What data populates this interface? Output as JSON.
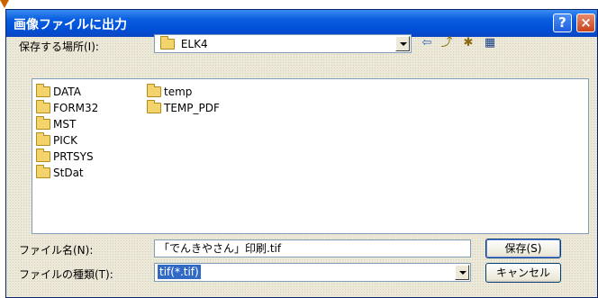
{
  "dialog": {
    "title": "画像ファイルに出力",
    "help_label": "?",
    "close_label": "×"
  },
  "location": {
    "label": "保存する場所(I):",
    "folder": "ELK4"
  },
  "toolbar": {
    "back_icon": "⇦",
    "up_icon": "⤴",
    "new_folder_icon": "✱",
    "view_menu_icon": "▦"
  },
  "files": [
    {
      "name": "DATA"
    },
    {
      "name": "FORM32"
    },
    {
      "name": "MST"
    },
    {
      "name": "PICK"
    },
    {
      "name": "PRTSYS"
    },
    {
      "name": "StDat"
    },
    {
      "name": "temp"
    },
    {
      "name": "TEMP_PDF"
    }
  ],
  "filename": {
    "label": "ファイル名(N):",
    "value": "「でんきやさん」印刷.tif"
  },
  "filetype": {
    "label": "ファイルの種類(T):",
    "value": "tif(*.tif)"
  },
  "buttons": {
    "save": "保存(S)",
    "cancel": "キャンセル"
  },
  "colors": {
    "titlebar": "#0050d8",
    "selection": "#316ac5",
    "dialog_bg": "#ece9d8"
  }
}
